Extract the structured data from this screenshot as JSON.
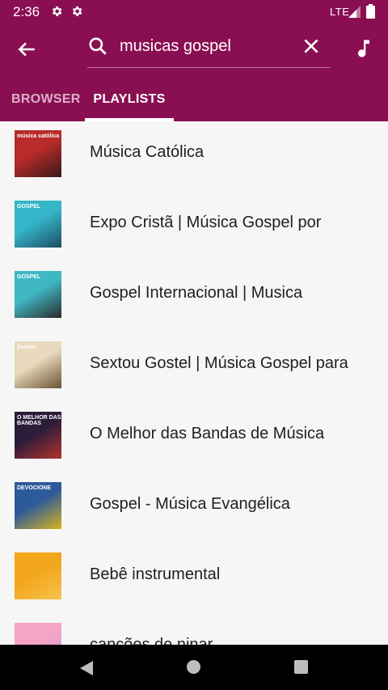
{
  "status": {
    "time": "2:36",
    "network": "LTE",
    "icons": [
      "gear-icon",
      "gear-icon",
      "signal-icon",
      "battery-icon"
    ]
  },
  "search": {
    "query": "musicas gospel"
  },
  "tabs": [
    {
      "label": "BROWSER",
      "selected": false
    },
    {
      "label": "PLAYLISTS",
      "selected": true
    }
  ],
  "playlists": [
    {
      "title": "Música Católica",
      "thumb_text": "música católica",
      "thumb_colors": [
        "#b92a2a",
        "#3a1a1a"
      ]
    },
    {
      "title": "Expo Cristã | Música Gospel por",
      "thumb_text": "GOSPEL",
      "thumb_colors": [
        "#35b6c8",
        "#1d4d63"
      ]
    },
    {
      "title": "Gospel Internacional | Musica",
      "thumb_text": "GOSPEL",
      "thumb_colors": [
        "#3fb8c4",
        "#2a2a2a"
      ]
    },
    {
      "title": "Sextou Gostel | Música Gospel para",
      "thumb_text": "Sextou",
      "thumb_colors": [
        "#e9d9bd",
        "#6a5232"
      ]
    },
    {
      "title": "O Melhor das Bandas de Música",
      "thumb_text": "O MELHOR DAS BANDAS",
      "thumb_colors": [
        "#2b1c3a",
        "#b3322f"
      ]
    },
    {
      "title": "Gospel - Música Evangélica",
      "thumb_text": "DEVOCIONE",
      "thumb_colors": [
        "#2d5b9a",
        "#d7b21c"
      ]
    },
    {
      "title": "Bebê instrumental",
      "thumb_text": "",
      "thumb_colors": [
        "#f2a61c",
        "#f6c24e"
      ]
    },
    {
      "title": "canções de ninar",
      "thumb_text": "",
      "thumb_colors": [
        "#f5a4c4",
        "#b79be6"
      ]
    }
  ],
  "colors": {
    "appbar": "#8a0f52",
    "indicator": "#ffffff",
    "list_bg": "#f6f6f6"
  }
}
